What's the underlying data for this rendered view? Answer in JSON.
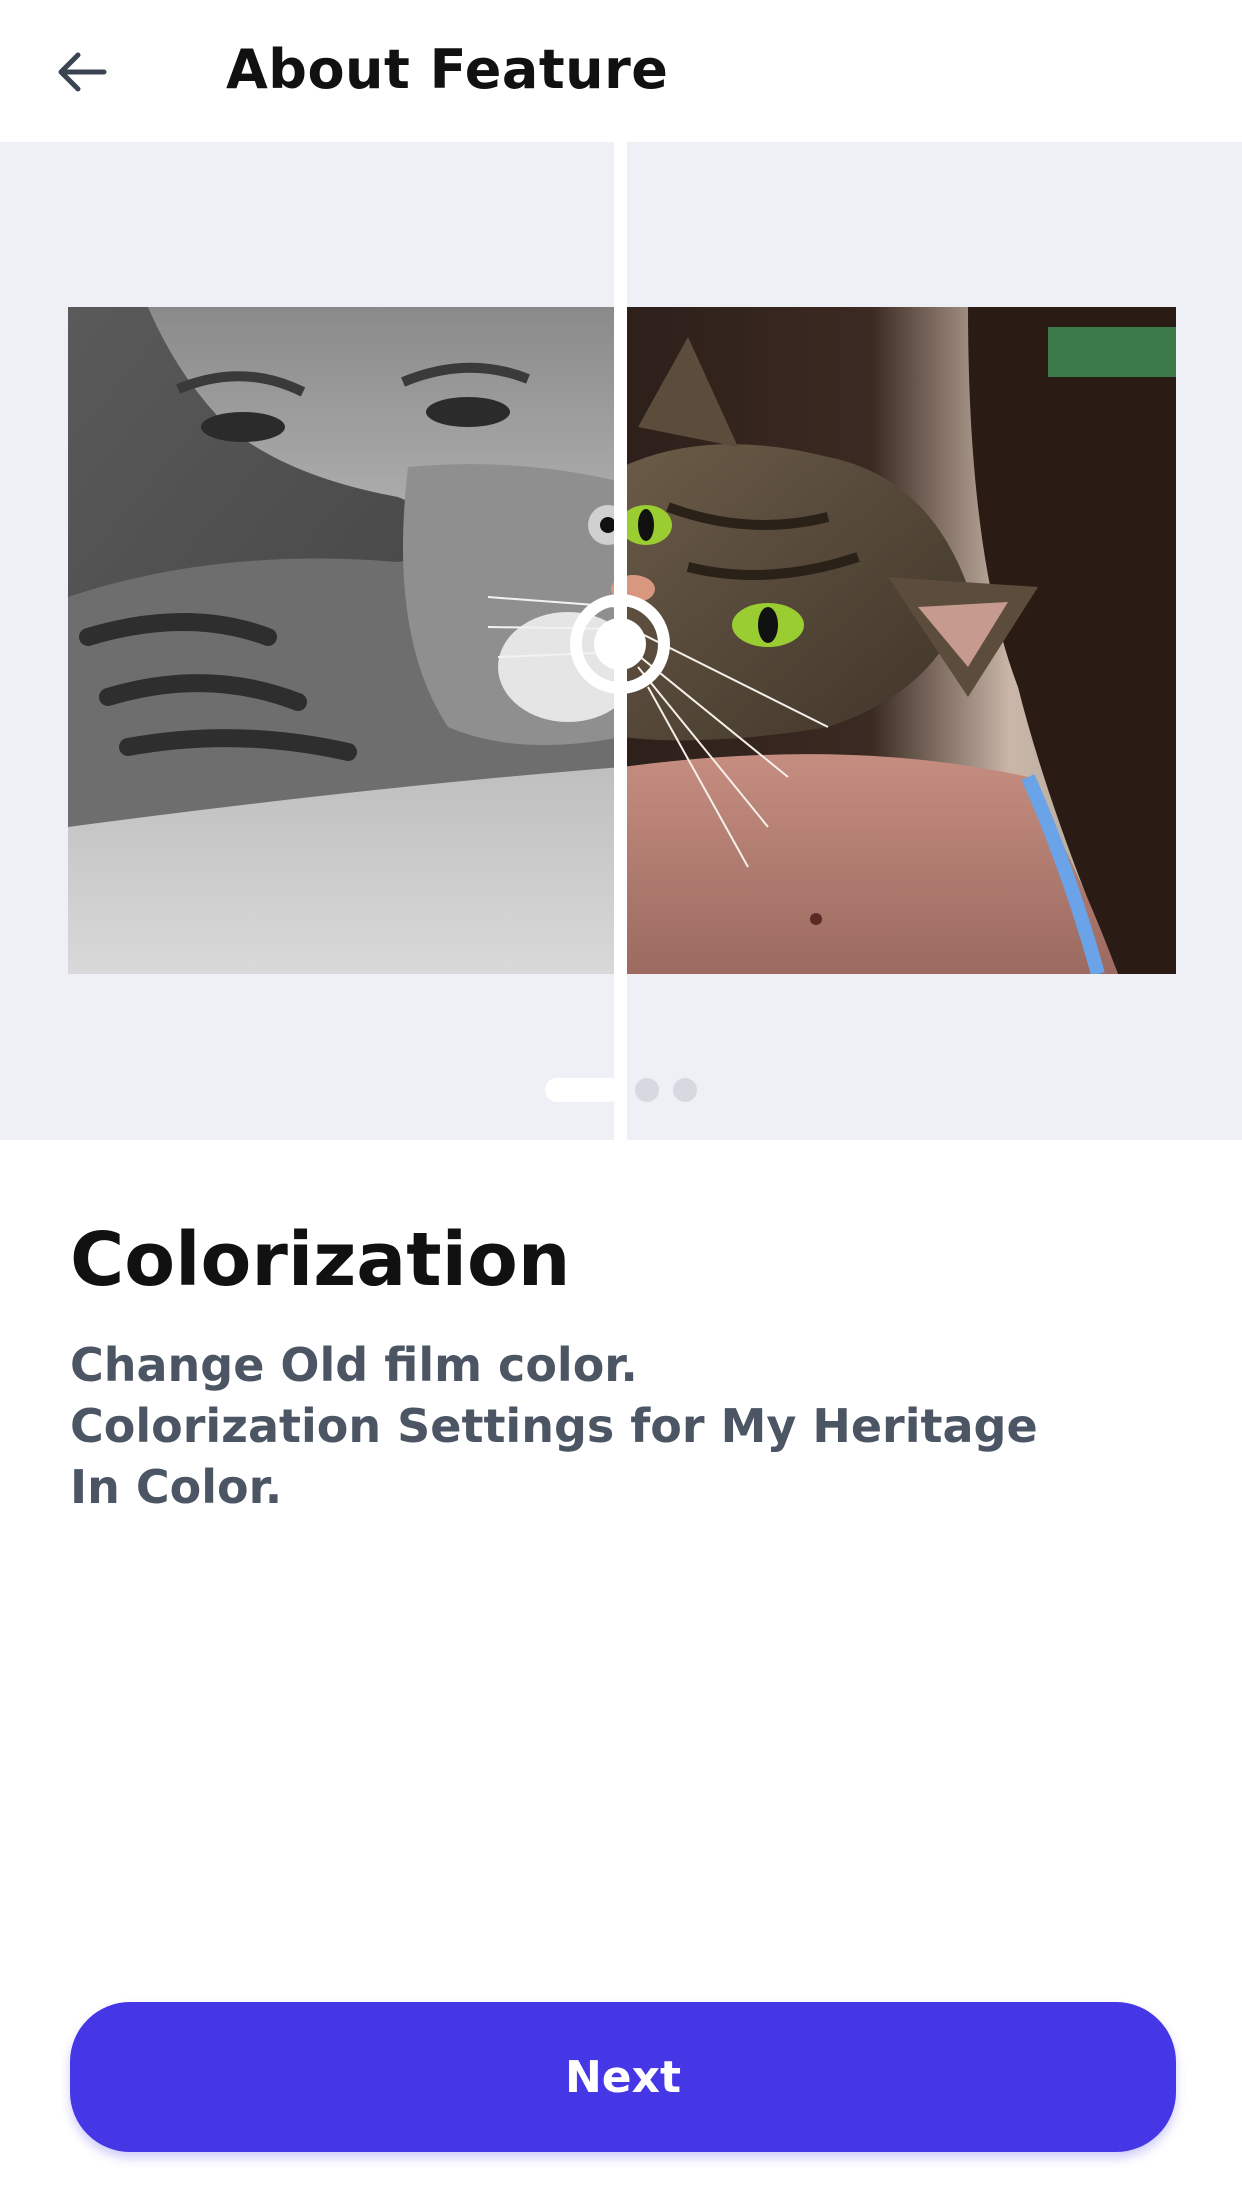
{
  "header": {
    "title": "About Feature",
    "back_icon": "arrow-left-icon"
  },
  "preview": {
    "background": "#eef0f5",
    "image_left": "grayscale woman hugging cat",
    "image_right": "color woman hugging cat",
    "pagination": {
      "total": 3,
      "active": 1
    }
  },
  "feature": {
    "title": "Colorization",
    "description_lines": [
      "Change Old film color.",
      "Colorization Settings for My Heritage",
      "In Color."
    ]
  },
  "footer": {
    "next_label": "Next",
    "accent": "#4536e6"
  }
}
